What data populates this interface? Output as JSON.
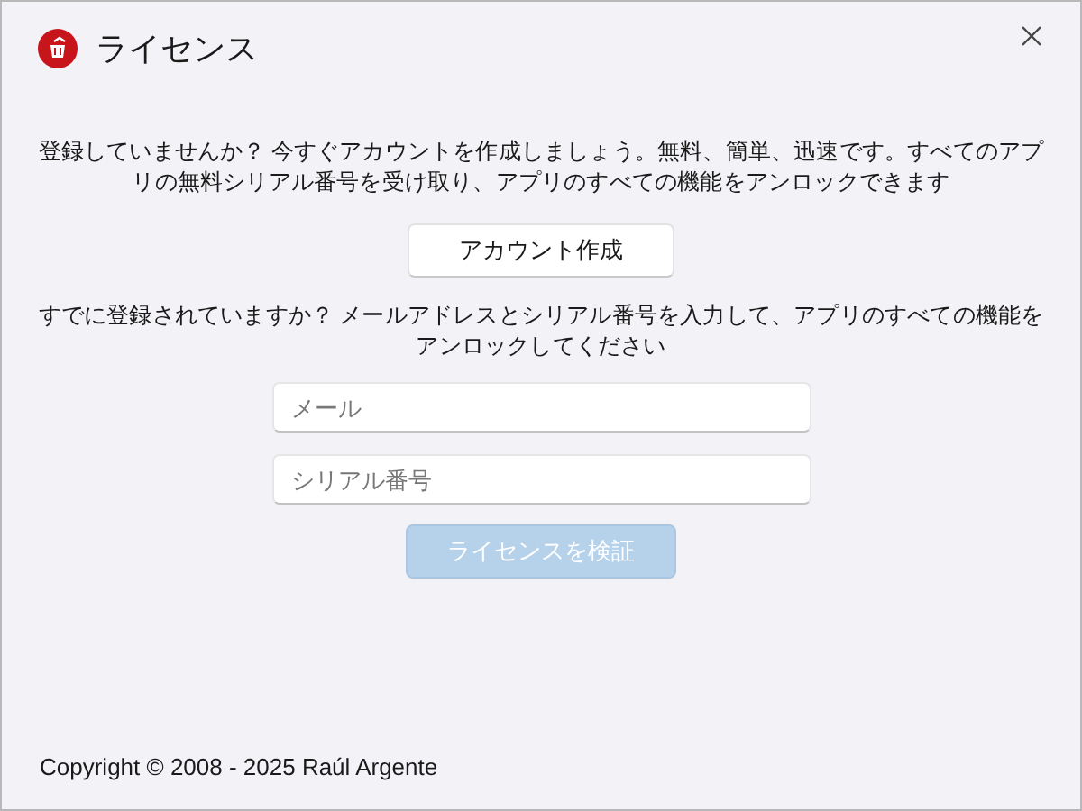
{
  "window": {
    "title": "ライセンス"
  },
  "register": {
    "message": "登録していませんか？ 今すぐアカウントを作成しましょう。無料、簡単、迅速です。すべてのアプリの無料シリアル番号を受け取り、アプリのすべての機能をアンロックできます",
    "button": "アカウント作成"
  },
  "activate": {
    "message": "すでに登録されていますか？ メールアドレスとシリアル番号を入力して、アプリのすべての機能をアンロックしてください",
    "email": {
      "placeholder": "メール"
    },
    "serial": {
      "placeholder": "シリアル番号"
    },
    "verify_button": {
      "label": "ライセンスを検証",
      "disabled": true
    }
  },
  "footer": "Copyright © 2008 - 2025 Raúl Argente"
}
